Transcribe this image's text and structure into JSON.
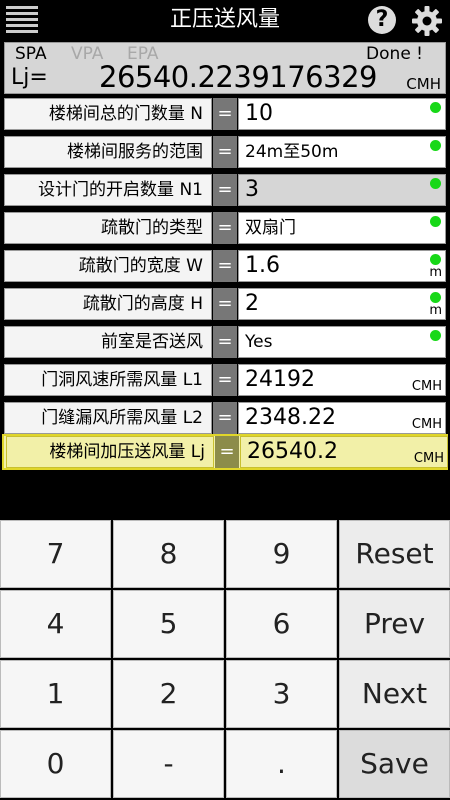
{
  "header": {
    "title": "正压送风量"
  },
  "result": {
    "modes": [
      "SPA",
      "VPA",
      "EPA"
    ],
    "status": "Done !",
    "label": "Lj=",
    "value": "26540.2239176329",
    "unit": "CMH"
  },
  "rows": [
    {
      "label": "楼梯间总的门数量  N",
      "eq": "=",
      "value": "10",
      "unit": ""
    },
    {
      "label": "楼梯间服务的范围",
      "eq": "=",
      "value": "24m至50m",
      "unit": ""
    },
    {
      "label": "设计门的开启数量 N1",
      "eq": "=",
      "value": "3",
      "unit": ""
    },
    {
      "label": "疏散门的类型",
      "eq": "=",
      "value": "双扇门",
      "unit": ""
    },
    {
      "label": "疏散门的宽度  W",
      "eq": "=",
      "value": "1.6",
      "unit": "m"
    },
    {
      "label": "疏散门的高度  H",
      "eq": "=",
      "value": "2",
      "unit": "m"
    },
    {
      "label": "前室是否送风",
      "eq": "=",
      "value": "Yes",
      "unit": ""
    },
    {
      "label": "门洞风速所需风量 L1",
      "eq": "=",
      "value": "24192",
      "unit": "CMH"
    },
    {
      "label": "门缝漏风所需风量 L2",
      "eq": "=",
      "value": "2348.22",
      "unit": "CMH"
    },
    {
      "label": "楼梯间加压送风量  Lj",
      "eq": "=",
      "value": "26540.2",
      "unit": "CMH"
    }
  ],
  "keypad": {
    "keys": [
      "7",
      "8",
      "9",
      "Reset",
      "4",
      "5",
      "6",
      "Prev",
      "1",
      "2",
      "3",
      "Next",
      "0",
      "-",
      ".",
      "Save"
    ]
  },
  "colors": {
    "status_dot": "#17d817",
    "highlight": "#f2f0a8"
  }
}
